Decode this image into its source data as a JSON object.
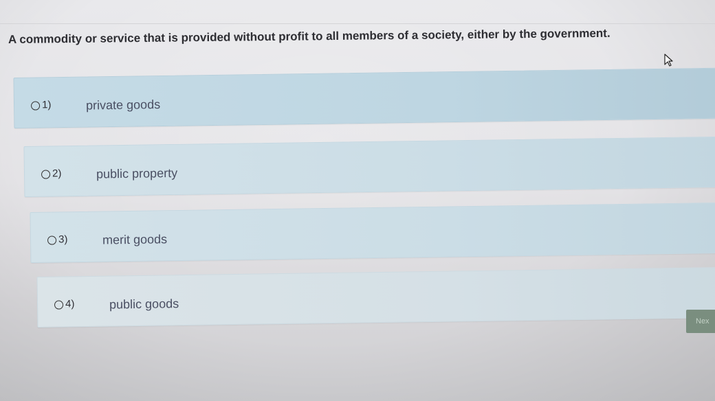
{
  "question": {
    "text": "A commodity or service that is provided without profit to all members of a society, either by the government."
  },
  "options": [
    {
      "number": "1)",
      "label": "private goods"
    },
    {
      "number": "2)",
      "label": "public property"
    },
    {
      "number": "3)",
      "label": "merit goods"
    },
    {
      "number": "4)",
      "label": "public goods"
    }
  ],
  "next_button": {
    "label": "Nex"
  },
  "colors": {
    "option_background": "#c5dbe6",
    "next_button": "#7a8e7f"
  },
  "icons": {
    "cursor": "mouse-pointer-icon",
    "radio": "radio-circle-icon"
  }
}
